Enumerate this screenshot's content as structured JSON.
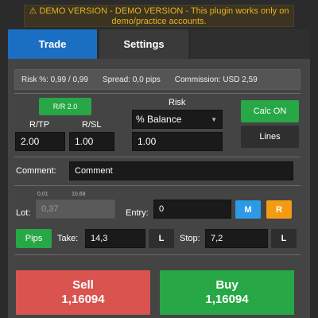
{
  "banner": {
    "text": "⚠ DEMO VERSION - DEMO VERSION - This plugin works only on demo/practice accounts."
  },
  "tabs": [
    {
      "label": "Trade"
    },
    {
      "label": "Settings"
    }
  ],
  "info": {
    "risk": "Risk %: 0,99 / 0,99",
    "spread": "Spread: 0,0 pips",
    "commission": "Commission: USD 2,59"
  },
  "rr": {
    "badge": "R/R 2.0",
    "tp_label": "R/TP",
    "sl_label": "R/SL",
    "tp_value": "2.00",
    "sl_value": "1.00"
  },
  "risk": {
    "label": "Risk",
    "mode": "% Balance",
    "value": "1.00"
  },
  "side_buttons": {
    "calc": "Calc ON",
    "lines": "Lines"
  },
  "comment": {
    "label": "Comment:",
    "value": "Comment"
  },
  "lot": {
    "label": "Lot:",
    "value": "0,37",
    "min": "0,01",
    "max": "10,68"
  },
  "entry": {
    "label": "Entry:",
    "value": "0",
    "m": "M",
    "r": "R"
  },
  "pips": {
    "toggle": "Pips",
    "take_label": "Take:",
    "take_value": "14,3",
    "take_l": "L",
    "stop_label": "Stop:",
    "stop_value": "7,2",
    "stop_l": "L"
  },
  "sell": {
    "label": "Sell",
    "price": "1,16094"
  },
  "buy": {
    "label": "Buy",
    "price": "1,16094"
  },
  "colors": {
    "accent": "#1b6fc3",
    "green": "#27a745",
    "red": "#d9534f",
    "orange": "#f39c12",
    "warning": "#e6b422"
  }
}
